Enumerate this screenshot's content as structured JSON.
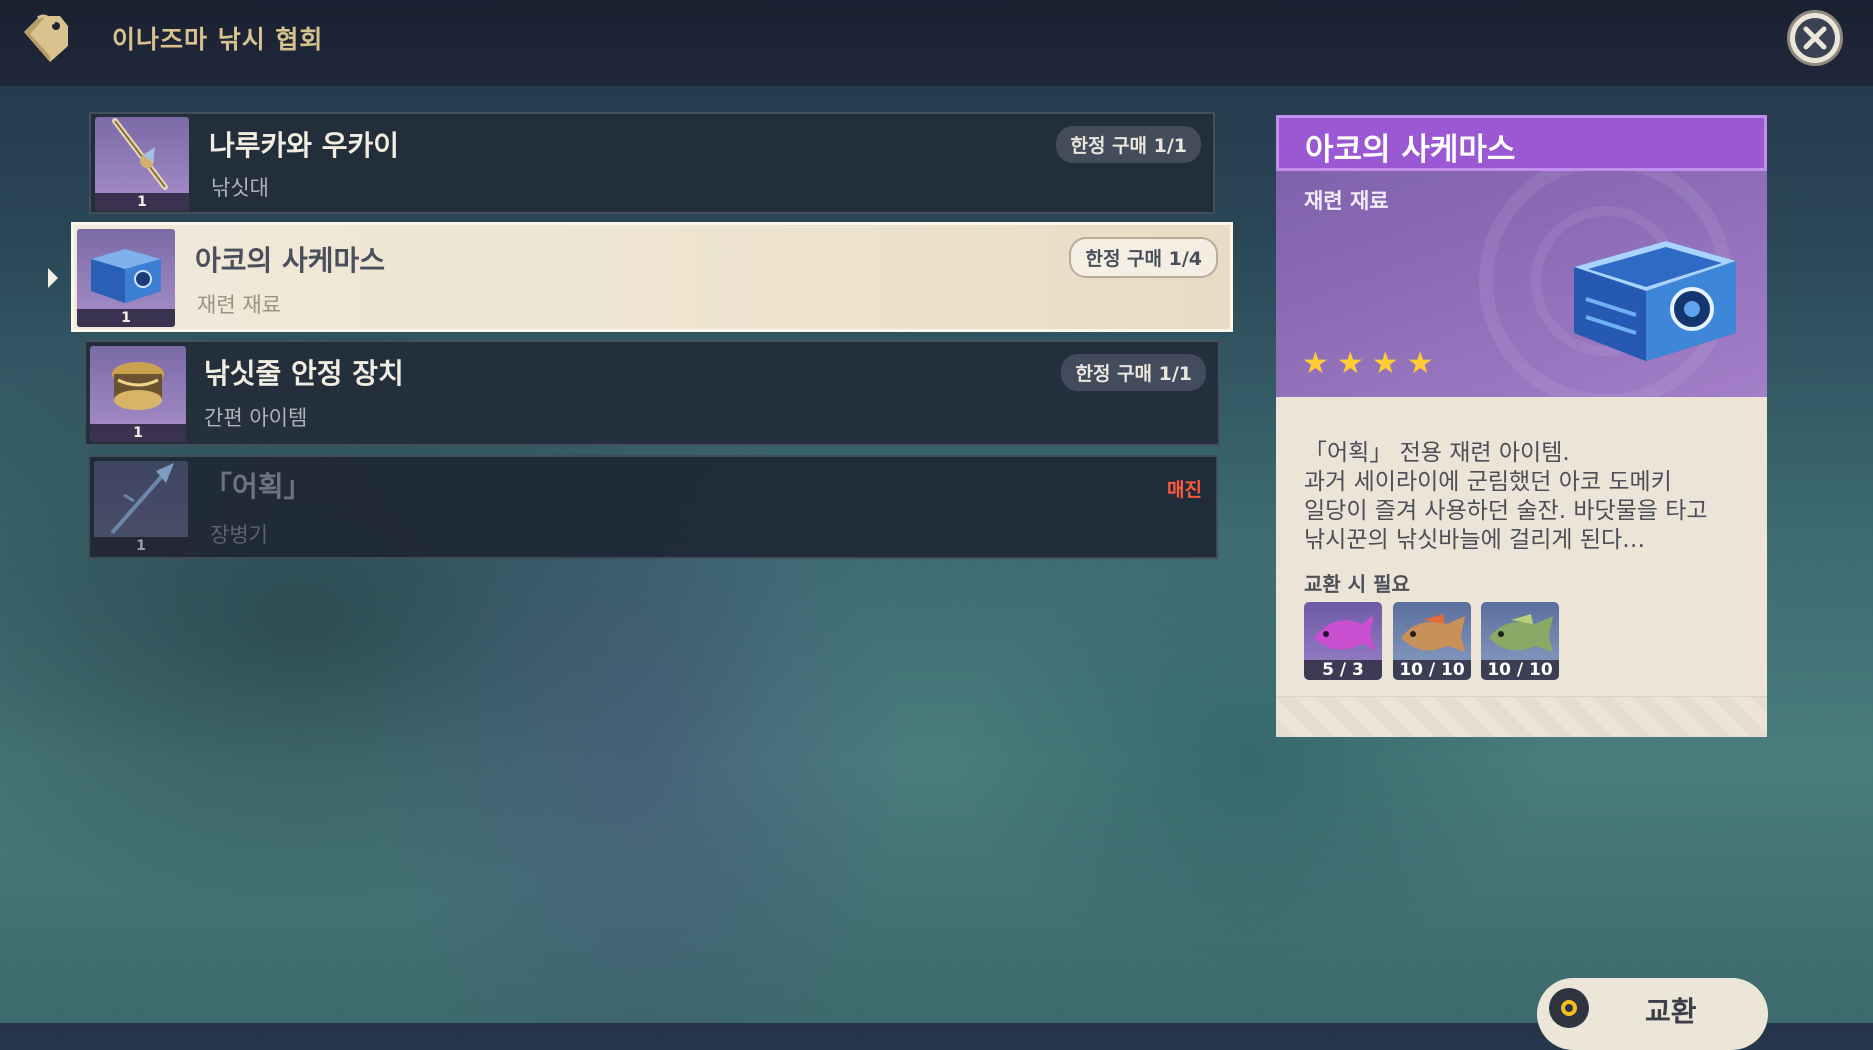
{
  "header": {
    "title": "이나즈마 낚시 협회",
    "icon": "shop-tag-icon",
    "close_icon": "close-icon"
  },
  "items": [
    {
      "name": "나루카와 우카이",
      "type": "낚싯대",
      "limit": "한정 구매 1/1",
      "qty": "1",
      "icon": "fishing-rod-icon"
    },
    {
      "name": "아코의 사케마스",
      "type": "재련 재료",
      "limit": "한정 구매 1/4",
      "qty": "1",
      "icon": "sake-box-icon"
    },
    {
      "name": "낚싯줄 안정 장치",
      "type": "간편 아이템",
      "limit": "한정 구매 1/1",
      "qty": "1",
      "icon": "line-stabilizer-icon"
    },
    {
      "name": "「어획」",
      "type": "장병기",
      "status": "매진",
      "qty": "1",
      "icon": "polearm-icon"
    }
  ],
  "detail": {
    "title": "아코의 사케마스",
    "subtitle": "재련 재료",
    "stars": [
      "★",
      "★",
      "★",
      "★"
    ],
    "description": [
      "「어획」 전용 재련 아이템.",
      "과거 세이라이에 군림했던 아코 도메키",
      "일당이 즐겨 사용하던 술잔. 바닷물을 타고",
      "낚시꾼의 낚싯바늘에 걸리게 된다…"
    ],
    "requirement_label": "교환 시 필요",
    "materials": [
      {
        "count": "5 / 3",
        "icon": "purple-fish-icon"
      },
      {
        "count": "10 / 10",
        "icon": "brown-fish-icon"
      },
      {
        "count": "10 / 10",
        "icon": "green-fish-icon"
      }
    ]
  },
  "exchange": {
    "label": "교환",
    "icon": "confirm-circle-icon"
  },
  "colors": {
    "accent": "#9a58d3",
    "star": "#ffcc33",
    "soldout": "#ff5a3c"
  }
}
